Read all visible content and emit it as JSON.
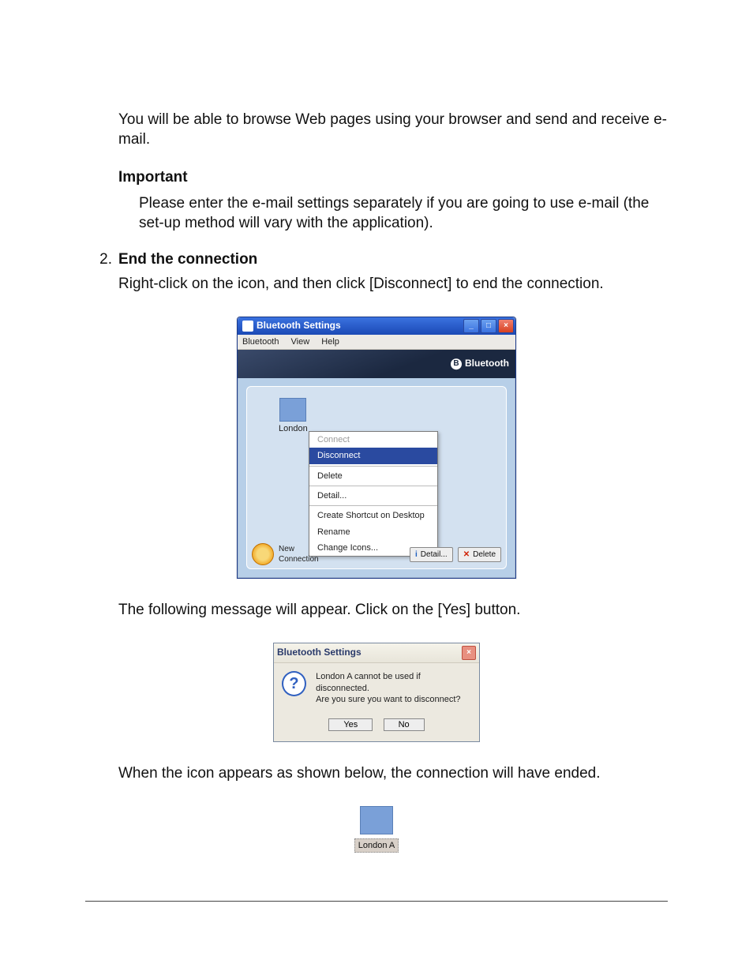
{
  "doc": {
    "intro": "You will be able to browse Web pages using your browser and send and receive e-mail.",
    "important_heading": "Important",
    "important_body": "Please enter the e-mail settings separately if you are going to use e-mail (the set-up method will vary with the application).",
    "step_num": "2.",
    "step_title": "End the connection",
    "step_body": "Right-click on the icon, and then click [Disconnect] to end the connection.",
    "after1": "The following message will appear. Click on the [Yes] button.",
    "after2": "When the icon appears as shown below, the connection will have ended."
  },
  "win1": {
    "title": "Bluetooth Settings",
    "menu": {
      "bluetooth": "Bluetooth",
      "view": "View",
      "help": "Help"
    },
    "banner": "Bluetooth",
    "device_label": "London",
    "context_menu": {
      "connect": "Connect",
      "disconnect": "Disconnect",
      "delete": "Delete",
      "detail": "Detail...",
      "create_shortcut": "Create Shortcut on Desktop",
      "rename": "Rename",
      "change_icons": "Change Icons..."
    },
    "new_connection": "New\nConnection",
    "detail_btn": "Detail...",
    "delete_btn": "Delete"
  },
  "dialog": {
    "title": "Bluetooth Settings",
    "line1": "London A cannot be used if disconnected.",
    "line2": "Are you sure you want to disconnect?",
    "yes": "Yes",
    "no": "No"
  },
  "icon3": {
    "label": "London A"
  }
}
